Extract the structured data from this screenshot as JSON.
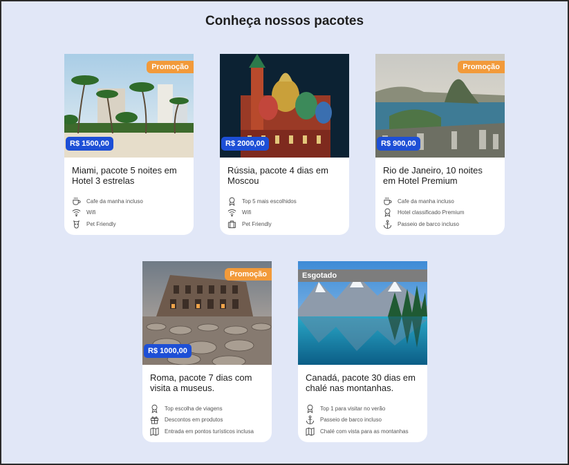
{
  "page": {
    "title": "Conheça nossos pacotes"
  },
  "cards": [
    {
      "tag": "Promoção",
      "price": "R$ 1500,00",
      "title": "Miami, pacote 5 noites em Hotel 3 estrelas",
      "features": [
        {
          "icon": "coffee-icon",
          "label": "Cafe da manha incluso"
        },
        {
          "icon": "wifi-icon",
          "label": "Wifi"
        },
        {
          "icon": "pet-icon",
          "label": "Pet Friendly"
        }
      ]
    },
    {
      "tag": "",
      "price": "R$ 2000,00",
      "title": "Rússia, pacote 4 dias em Moscou",
      "features": [
        {
          "icon": "award-icon",
          "label": "Top 5 mais escolhidos"
        },
        {
          "icon": "wifi-icon",
          "label": "Wifi"
        },
        {
          "icon": "luggage-icon",
          "label": "Pet Friendly"
        }
      ]
    },
    {
      "tag": "Promoção",
      "price": "R$ 900,00",
      "title": "Rio de Janeiro, 10 noites em Hotel Premium",
      "features": [
        {
          "icon": "coffee-icon",
          "label": "Cafe da manha incluso"
        },
        {
          "icon": "award-icon",
          "label": "Hotel classificado Premium"
        },
        {
          "icon": "anchor-icon",
          "label": "Passeio de barco incluso"
        }
      ]
    },
    {
      "tag": "Promoção",
      "price": "R$ 1000,00",
      "title": "Roma, pacote 7 dias com visita a museus.",
      "features": [
        {
          "icon": "award-icon",
          "label": "Top escolha de viagens"
        },
        {
          "icon": "gift-icon",
          "label": "Descontos em produtos"
        },
        {
          "icon": "map-icon",
          "label": "Entrada em pontos turísticos inclusa"
        }
      ]
    },
    {
      "tag": "Esgotado",
      "price": "",
      "title": "Canadá, pacote 30 dias em chalé nas montanhas.",
      "features": [
        {
          "icon": "award-icon",
          "label": "Top 1 para visitar no verão"
        },
        {
          "icon": "anchor-icon",
          "label": "Passeio de barco incluso"
        },
        {
          "icon": "map-icon",
          "label": "Chalé com vista para as montanhas"
        }
      ]
    }
  ],
  "colors": {
    "background": "#e1e7f7",
    "promo_tag": "#f29a3a",
    "soldout_tag": "#7d7d7d",
    "price_badge": "#1d4fd6"
  }
}
